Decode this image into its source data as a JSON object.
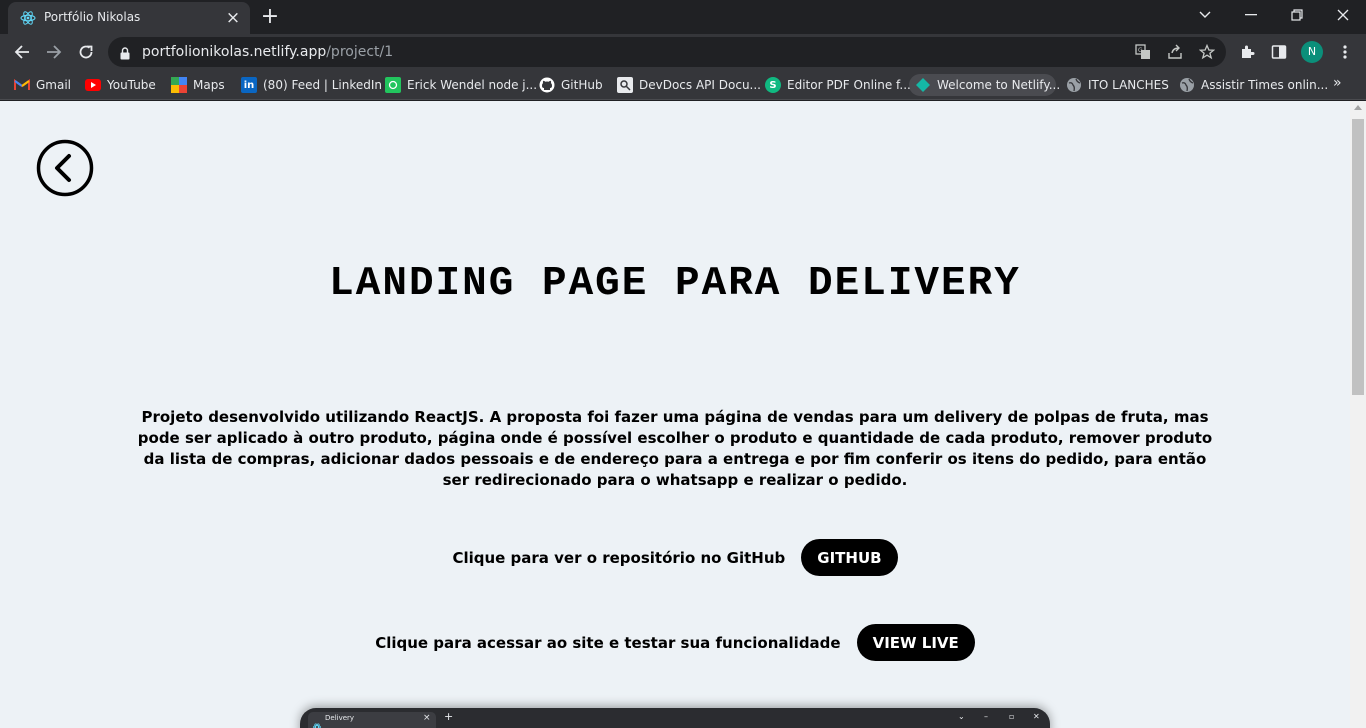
{
  "browser": {
    "tab": {
      "title": "Portfólio Nikolas",
      "favicon": "react-icon"
    },
    "window_controls": [
      "chevron-down-icon",
      "minimize-icon",
      "restore-icon",
      "close-icon"
    ],
    "url": {
      "host": "portfolionikolas.netlify.app",
      "path": "/project/1"
    },
    "profile_initial": "N",
    "accent": "#0b8f7a",
    "bookmarks": [
      {
        "label": "Gmail",
        "icon": "gmail-icon",
        "color": "#ea4335"
      },
      {
        "label": "YouTube",
        "icon": "youtube-icon",
        "color": "#ff0000"
      },
      {
        "label": "Maps",
        "icon": "maps-icon",
        "color": "#34a853"
      },
      {
        "label": "(80) Feed | LinkedIn",
        "icon": "linkedin-icon",
        "color": "#0a66c2"
      },
      {
        "label": "Erick Wendel node j...",
        "icon": "erick-wendel-icon",
        "color": "#22c55e"
      },
      {
        "label": "GitHub",
        "icon": "github-icon",
        "color": "#ffffff"
      },
      {
        "label": "DevDocs API Docu...",
        "icon": "devdocs-icon",
        "color": "#e8eaed"
      },
      {
        "label": "Editor PDF Online f...",
        "icon": "pdf-editor-icon",
        "color": "#10b981"
      },
      {
        "label": "Welcome to Netlify...",
        "icon": "netlify-icon",
        "color": "#14b8a6"
      },
      {
        "label": "ITO LANCHES",
        "icon": "globe-icon",
        "color": "#9aa0a6"
      },
      {
        "label": "Assistir Times onlin...",
        "icon": "globe-icon",
        "color": "#9aa0a6"
      }
    ]
  },
  "page": {
    "title": "LANDING PAGE PARA DELIVERY",
    "description": "Projeto desenvolvido utilizando ReactJS. A proposta foi fazer uma página de vendas para um delivery de polpas de fruta, mas pode ser aplicado à outro produto, página onde é possível escolher o produto e quantidade de cada produto, remover produto da lista de compras, adicionar dados pessoais e de endereço para a entrega e por fim conferir os itens do pedido, para então ser redirecionado para o whatsapp e realizar o pedido.",
    "github_cta": {
      "text": "Clique para ver o repositório no GitHub",
      "button": "GITHUB"
    },
    "live_cta": {
      "text": "Clique para acessar ao site e testar sua funcionalidade",
      "button": "VIEW LIVE"
    },
    "preview": {
      "tab_title": "Delivery"
    },
    "background": "#edf2f6"
  }
}
